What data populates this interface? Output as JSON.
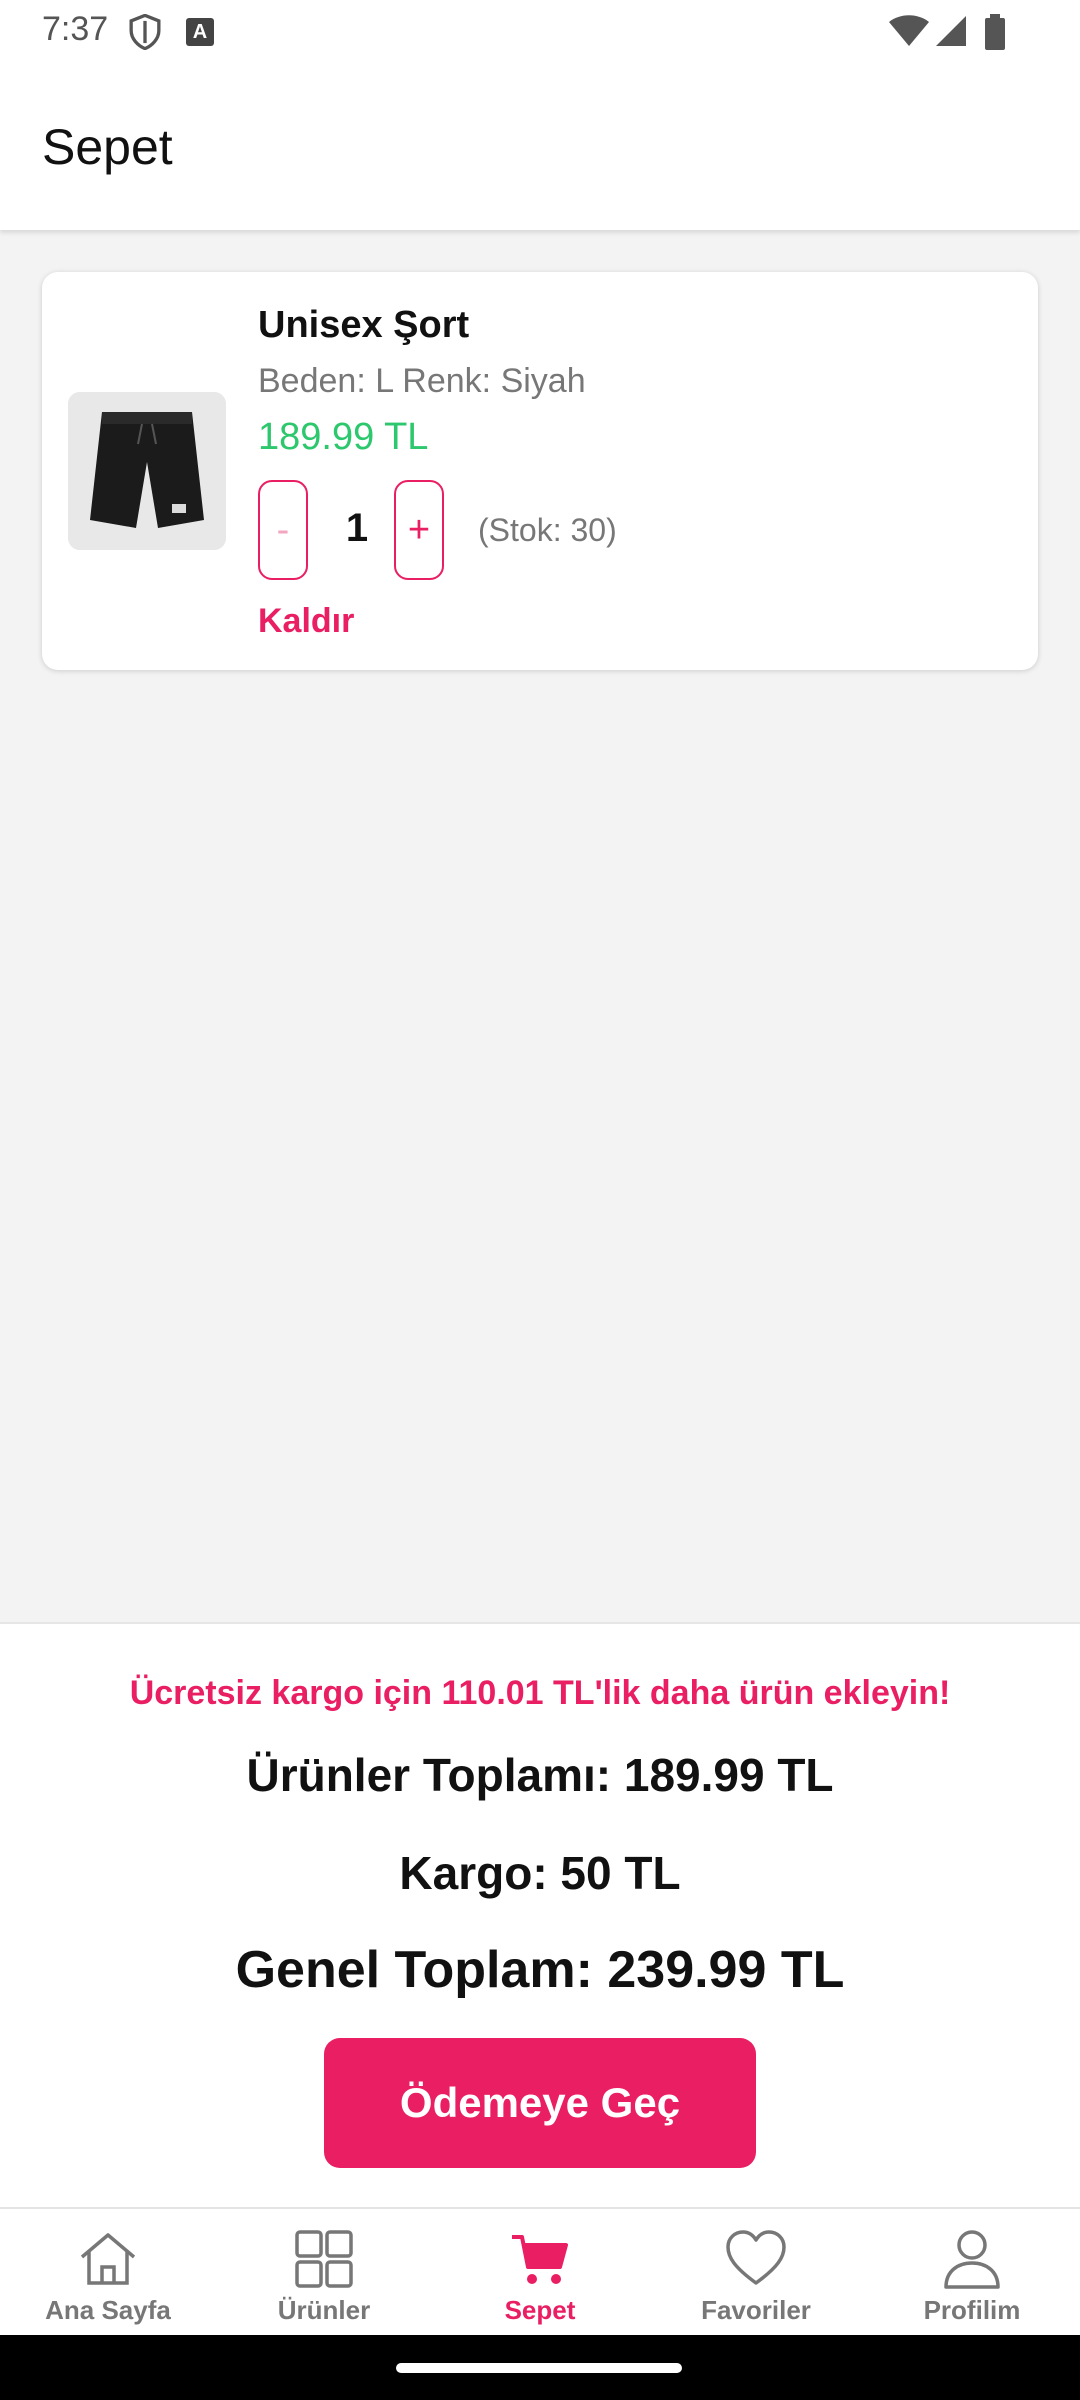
{
  "status_bar": {
    "time": "7:37",
    "icons": [
      "shield-icon",
      "text-a-icon",
      "wifi-icon",
      "signal-icon",
      "battery-icon"
    ]
  },
  "app_bar": {
    "title": "Sepet"
  },
  "cart": {
    "items": [
      {
        "name": "Unisex Şort",
        "variant": "Beden: L Renk: Siyah",
        "price": "189.99 TL",
        "minus_label": "-",
        "quantity": "1",
        "plus_label": "+",
        "stock": "(Stok: 30)",
        "remove_label": "Kaldır",
        "image_icon": "black-shorts-image"
      }
    ]
  },
  "summary": {
    "free_shipping_notice": "Ücretsiz kargo için 110.01 TL'lik daha ürün ekleyin!",
    "products_total": "Ürünler Toplamı: 189.99 TL",
    "cargo": "Kargo: 50 TL",
    "grand_total": "Genel Toplam: 239.99 TL",
    "checkout_label": "Ödemeye Geç"
  },
  "bottom_nav": {
    "items": [
      {
        "label": "Ana Sayfa",
        "icon": "home-icon",
        "active": false
      },
      {
        "label": "Ürünler",
        "icon": "grid-icon",
        "active": false
      },
      {
        "label": "Sepet",
        "icon": "cart-icon",
        "active": true
      },
      {
        "label": "Favoriler",
        "icon": "heart-icon",
        "active": false
      },
      {
        "label": "Profilim",
        "icon": "person-icon",
        "active": false
      }
    ]
  },
  "colors": {
    "accent": "#e91e63",
    "price_green": "#2dc76d",
    "background": "#f3f3f3"
  }
}
